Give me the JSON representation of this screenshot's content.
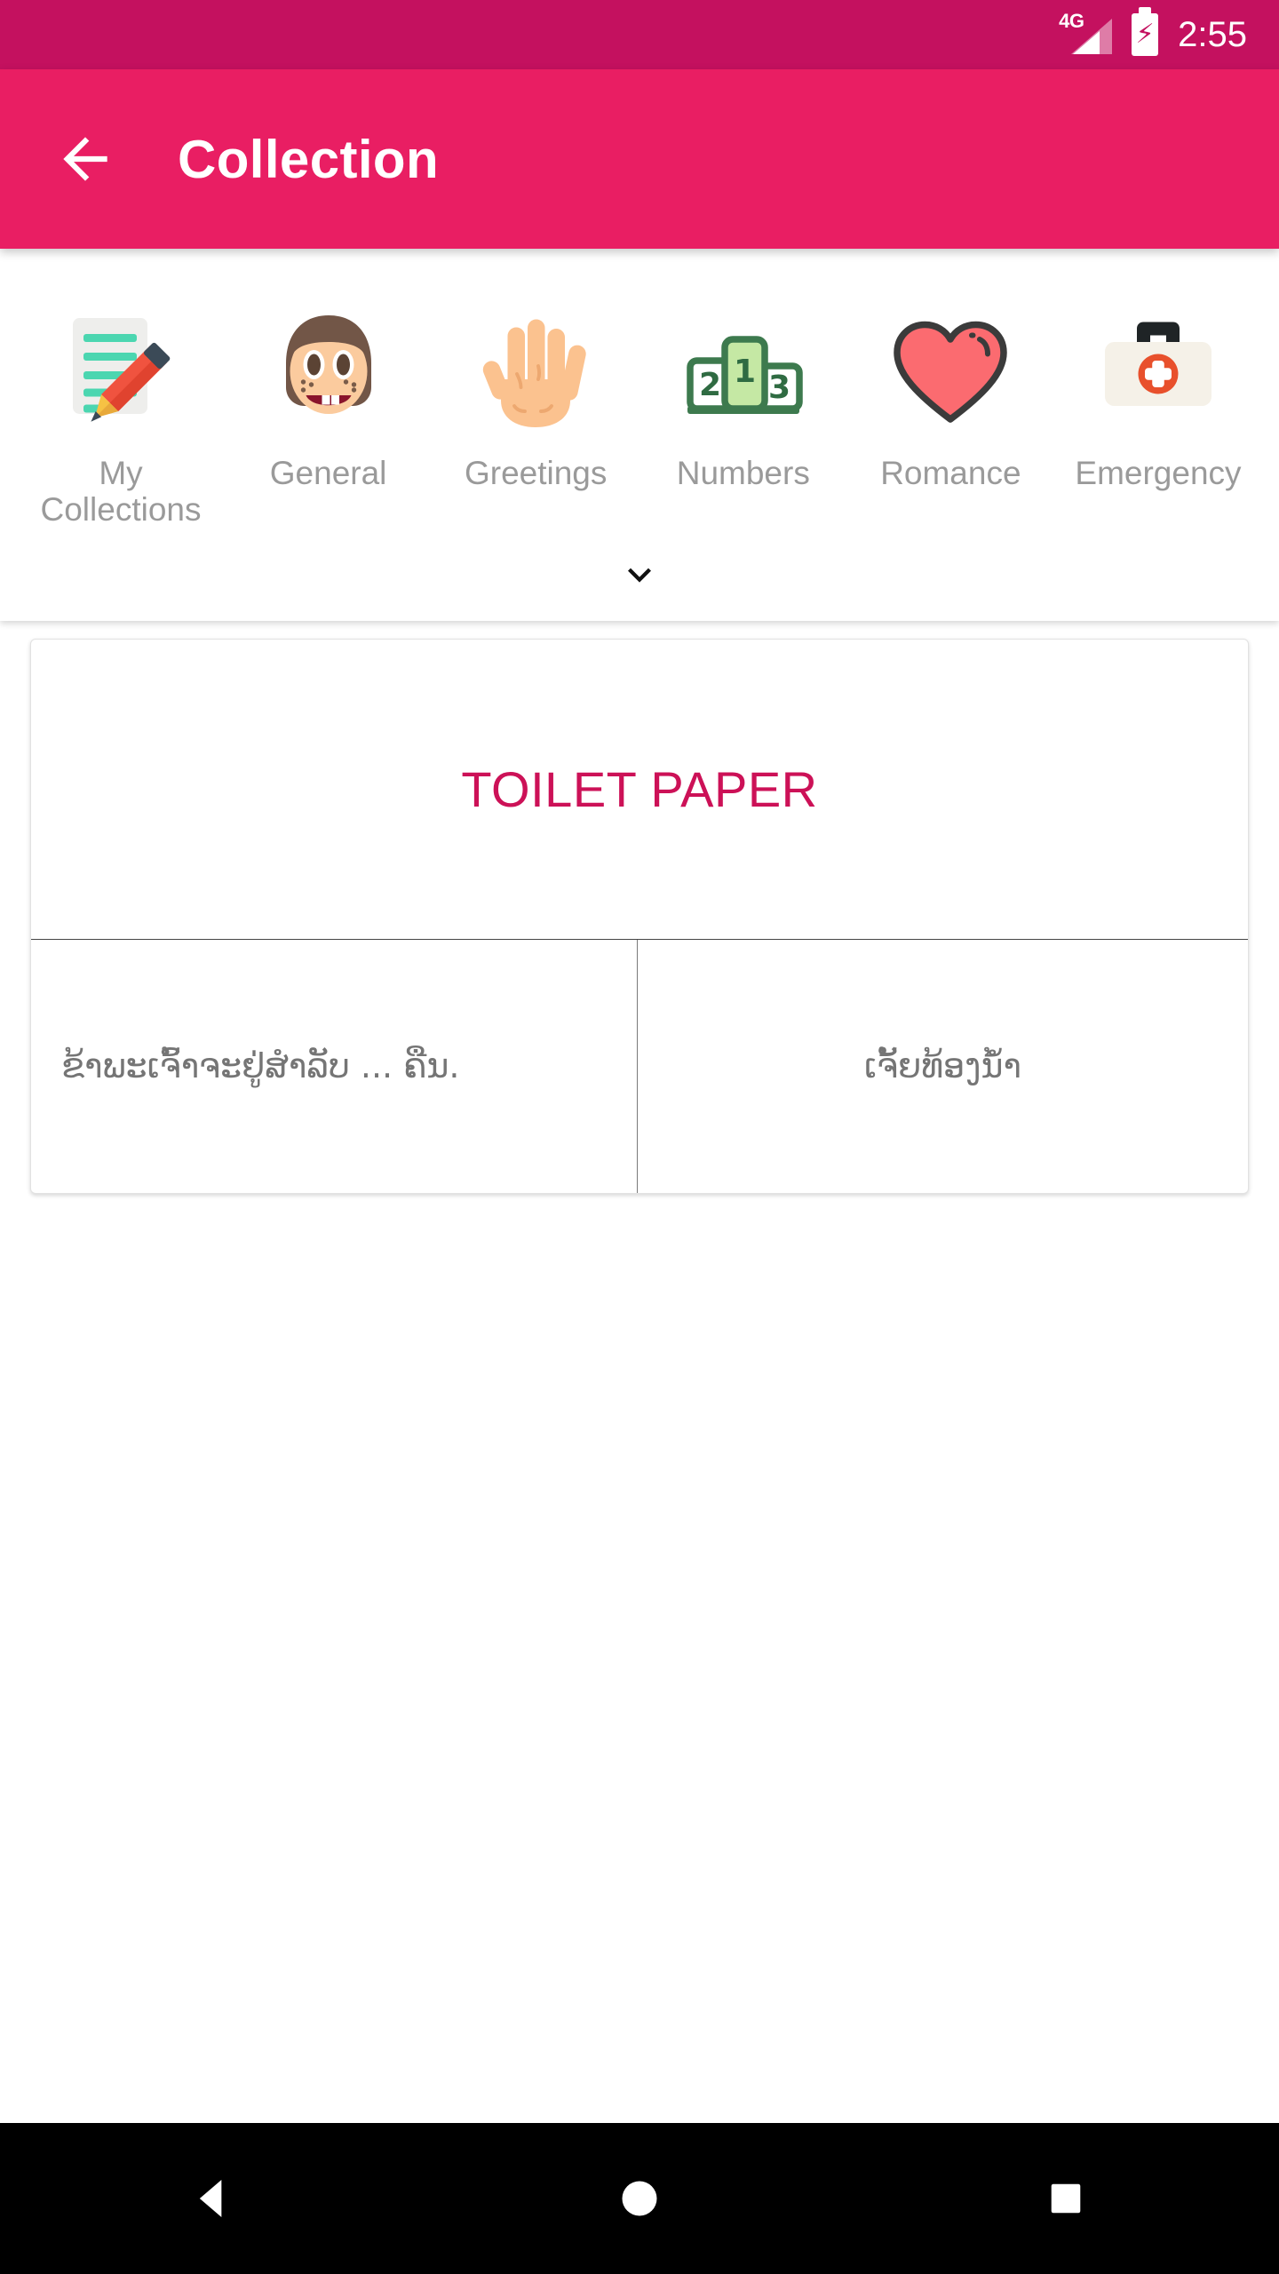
{
  "status_bar": {
    "network_label": "4G",
    "battery_icon": "battery-charging-icon",
    "time": "2:55",
    "background_color": "#c4115f"
  },
  "app_bar": {
    "back_icon": "arrow-left-icon",
    "title": "Collection",
    "background_color": "#e91e63",
    "text_color": "#ffffff"
  },
  "categories": {
    "expand_icon": "chevron-down-icon",
    "label_color": "#9a9a9a",
    "items": [
      {
        "label": "My Collections",
        "icon": "memo-pencil-icon"
      },
      {
        "label": "General",
        "icon": "girl-face-icon"
      },
      {
        "label": "Greetings",
        "icon": "open-hand-icon"
      },
      {
        "label": "Numbers",
        "icon": "podium-ranking-icon"
      },
      {
        "label": "Romance",
        "icon": "heart-icon"
      },
      {
        "label": "Emergency",
        "icon": "first-aid-kit-icon"
      }
    ]
  },
  "phrase_card": {
    "headline": "TOILET PAPER",
    "headline_color": "#cc1157",
    "translation_primary": "ຂ້າພະເຈົ້າຈະຢູ່ສໍາລັບ ... ຄືນ.",
    "translation_secondary": "ເຈັ້ຍທ້ອງນໍ້າ",
    "translation_color": "#757575"
  },
  "nav_bar": {
    "background_color": "#000000",
    "buttons": [
      {
        "name": "back",
        "icon": "triangle-back-icon"
      },
      {
        "name": "home",
        "icon": "circle-home-icon"
      },
      {
        "name": "recents",
        "icon": "square-recents-icon"
      }
    ]
  }
}
